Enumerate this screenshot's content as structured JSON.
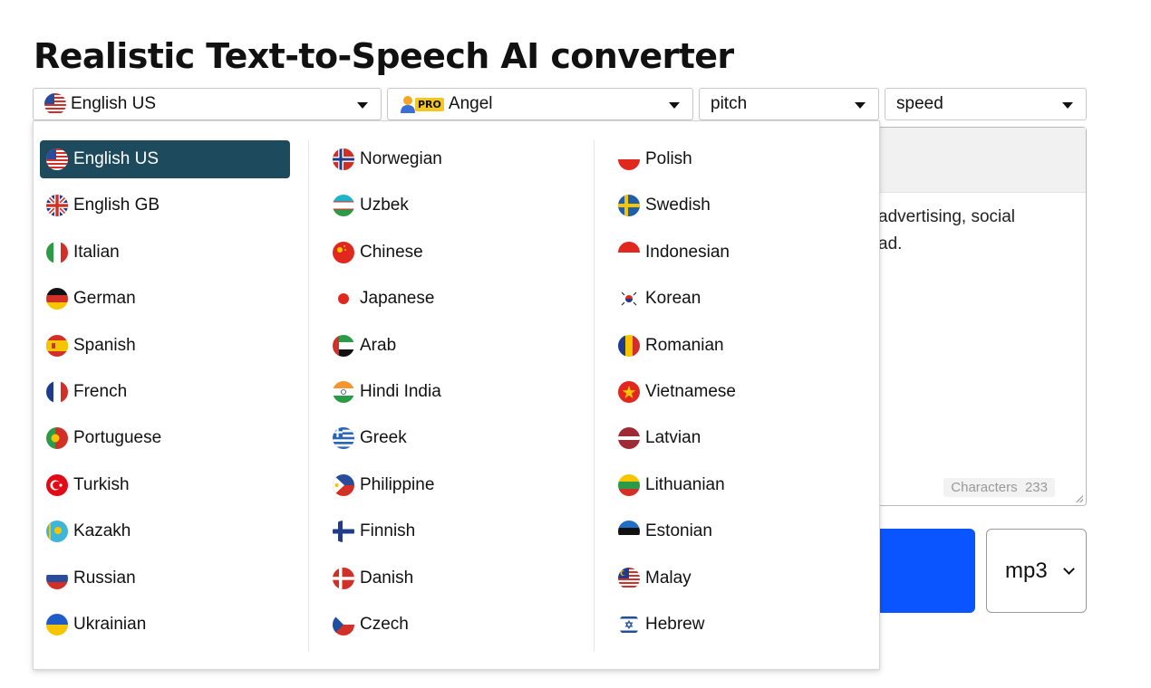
{
  "page": {
    "title": "Realistic Text-to-Speech AI converter"
  },
  "toolbar": {
    "language": {
      "value": "English US",
      "icon": "flag-us"
    },
    "voice": {
      "badge": "PRO",
      "value": "Angel",
      "icon": "user-icon"
    },
    "pitch": {
      "value": "pitch"
    },
    "speed": {
      "value": "speed"
    }
  },
  "editor": {
    "text_line1": "advertising, social",
    "text_line2": "ad.",
    "characters_label": "Characters",
    "characters_count": "233"
  },
  "output": {
    "format": "mp3",
    "accent_color": "#0a55ff"
  },
  "dropdown": {
    "selected": "English US",
    "selected_color": "#1d4a5c",
    "columns": [
      [
        "English US",
        "English GB",
        "Italian",
        "German",
        "Spanish",
        "French",
        "Portuguese",
        "Turkish",
        "Kazakh",
        "Russian",
        "Ukrainian"
      ],
      [
        "Norwegian",
        "Uzbek",
        "Chinese",
        "Japanese",
        "Arab",
        "Hindi India",
        "Greek",
        "Philippine",
        "Finnish",
        "Danish",
        "Czech"
      ],
      [
        "Polish",
        "Swedish",
        "Indonesian",
        "Korean",
        "Romanian",
        "Vietnamese",
        "Latvian",
        "Lithuanian",
        "Estonian",
        "Malay",
        "Hebrew"
      ]
    ]
  }
}
